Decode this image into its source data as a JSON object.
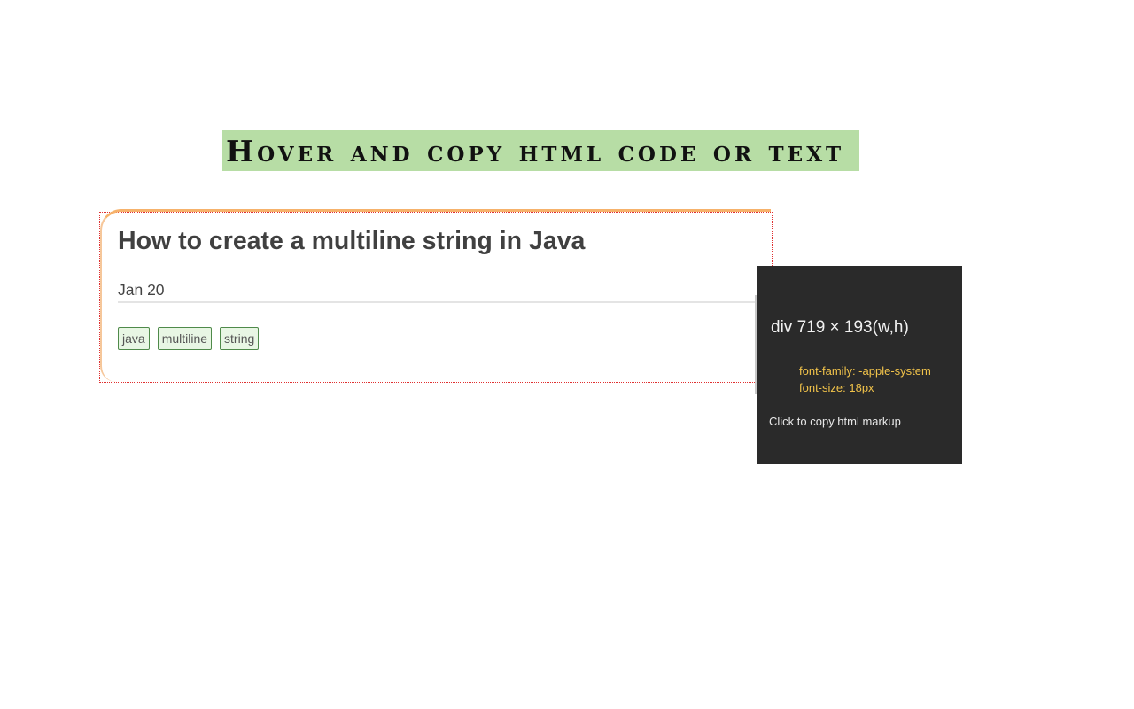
{
  "banner": {
    "text": "Hover and copy html code or text",
    "background": "#b7dda5"
  },
  "article": {
    "title": "How to create a multiline string in Java",
    "date": "Jan 20",
    "tags": [
      "java",
      "multiline",
      "string"
    ],
    "accent_border": "#f6b26b",
    "outline_color": "#e03030"
  },
  "inspector": {
    "size_label": "div 719 × 193(w,h)",
    "font_family_line": "font-family: -apple-system",
    "font_size_line": "font-size: 18px",
    "hint": "Click to copy html markup",
    "background": "#2a2a2a",
    "prop_color": "#f0c24a"
  }
}
